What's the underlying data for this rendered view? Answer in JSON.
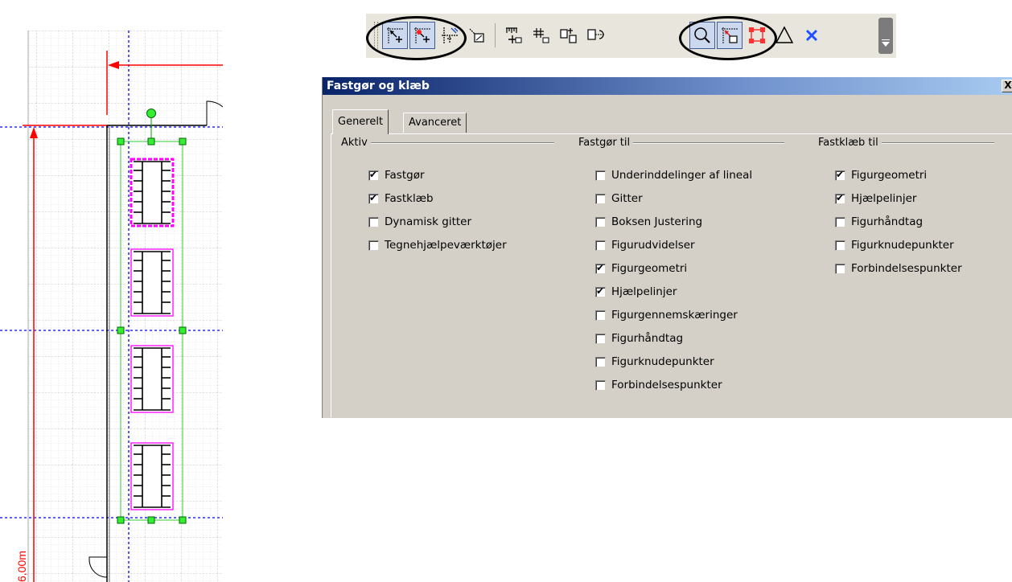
{
  "canvas": {
    "dimension_label": "6,00m"
  },
  "toolbar": {
    "buttons": [
      {
        "icon": "snap-icon",
        "pressed": true
      },
      {
        "icon": "glue-icon",
        "pressed": true
      },
      {
        "icon": "dynamic-grid-icon",
        "pressed": false
      },
      {
        "icon": "drawing-aids-icon",
        "pressed": false
      },
      {
        "icon": "snap-to-ruler-subdivisions-icon",
        "pressed": false
      },
      {
        "icon": "snap-to-grid-icon",
        "pressed": false
      },
      {
        "icon": "snap-to-alignment-box-icon",
        "pressed": false
      },
      {
        "icon": "snap-to-shape-extensions-icon",
        "pressed": false
      },
      {
        "icon": "snap-to-shape-geometry-icon",
        "pressed": true
      },
      {
        "icon": "snap-to-guides-icon",
        "pressed": true
      },
      {
        "icon": "snap-to-shape-handles-icon",
        "pressed": false
      },
      {
        "icon": "snap-to-shape-vertices-icon",
        "pressed": false
      },
      {
        "icon": "snap-to-connection-points-icon",
        "pressed": false
      }
    ],
    "overflow_icon": "toolbar-options-icon"
  },
  "dialog": {
    "title": "Fastgør og klæb",
    "close_label": "X",
    "tabs": [
      {
        "label": "Generelt",
        "active": true
      },
      {
        "label": "Avanceret",
        "active": false
      }
    ],
    "groups": [
      {
        "title": "Aktiv",
        "items": [
          {
            "label": "Fastgør",
            "checked": true
          },
          {
            "label": "Fastklæb",
            "checked": true
          },
          {
            "label": "Dynamisk gitter",
            "checked": false
          },
          {
            "label": "Tegnehjælpeværktøjer",
            "checked": false
          }
        ]
      },
      {
        "title": "Fastgør til",
        "items": [
          {
            "label": "Underinddelinger af lineal",
            "checked": false
          },
          {
            "label": "Gitter",
            "checked": false
          },
          {
            "label": "Boksen Justering",
            "checked": false
          },
          {
            "label": "Figurudvidelser",
            "checked": false
          },
          {
            "label": "Figurgeometri",
            "checked": true
          },
          {
            "label": "Hjælpelinjer",
            "checked": true
          },
          {
            "label": "Figurgennemskæringer",
            "checked": false
          },
          {
            "label": "Figurhåndtag",
            "checked": false
          },
          {
            "label": "Figurknudepunkter",
            "checked": false
          },
          {
            "label": "Forbindelsespunkter",
            "checked": false
          }
        ]
      },
      {
        "title": "Fastklæb til",
        "items": [
          {
            "label": "Figurgeometri",
            "checked": true
          },
          {
            "label": "Hjælpelinjer",
            "checked": true
          },
          {
            "label": "Figurhåndtag",
            "checked": false
          },
          {
            "label": "Figurknudepunkter",
            "checked": false
          },
          {
            "label": "Forbindelsespunkter",
            "checked": false
          }
        ]
      }
    ]
  },
  "colors": {
    "guide": "#0000ff",
    "dimension": "#ff0000",
    "selection": "#00a000",
    "table_outline": "#ff00ff",
    "pressed_button": "#cbd8ee",
    "dialog_bg": "#d4d0c8"
  }
}
